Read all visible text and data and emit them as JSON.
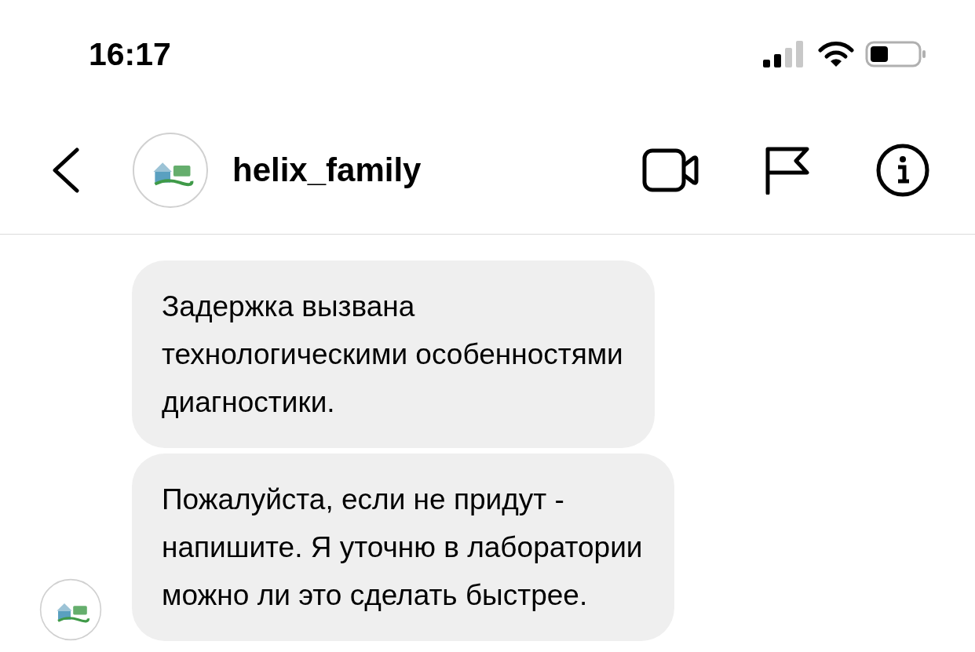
{
  "status_bar": {
    "time": "16:17"
  },
  "header": {
    "username": "helix_family"
  },
  "messages": [
    {
      "text": "Задержка вызвана\nтехнологическими особенностями\nдиагностики.",
      "show_avatar": false
    },
    {
      "text": "Пожалуйста, если не придут -\nнапишите. Я уточню в лаборатории\nможно ли это сделать быстрее.",
      "show_avatar": true
    }
  ]
}
